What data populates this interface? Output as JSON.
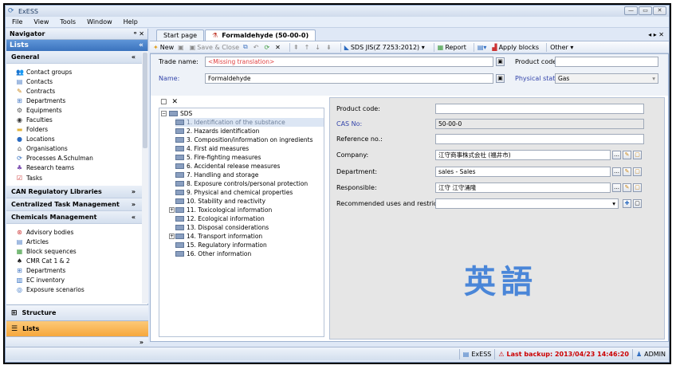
{
  "window": {
    "title": "ExESS",
    "min": "—",
    "max": "▭",
    "close": "✕"
  },
  "menu": [
    "File",
    "View",
    "Tools",
    "Window",
    "Help"
  ],
  "navigator": {
    "title": "Navigator",
    "pin": "ᵒ ✕",
    "lists_label": "Lists",
    "lists_chevron": "«",
    "groups": [
      {
        "label": "General",
        "chevron": "«",
        "items": [
          "Contact groups",
          "Contacts",
          "Contracts",
          "Departments",
          "Equipments",
          "Faculties",
          "Folders",
          "Locations",
          "Organisations",
          "Processes A.Schulman",
          "Research teams",
          "Tasks"
        ]
      },
      {
        "label": "CAN Regulatory Libraries",
        "chevron": "»",
        "items": []
      },
      {
        "label": "Centralized Task Management",
        "chevron": "»",
        "items": []
      },
      {
        "label": "Chemicals Management",
        "chevron": "«",
        "items": [
          "Advisory bodies",
          "Articles",
          "Block sequences",
          "CMR Cat 1 & 2",
          "Departments",
          "EC inventory",
          "Exposure scenarios"
        ]
      }
    ],
    "structure_label": "Structure",
    "lists_button_label": "Lists",
    "more": "»"
  },
  "tabs": [
    {
      "label": "Start page"
    },
    {
      "label": "Formaldehyde (50-00-0)"
    }
  ],
  "tab_controls": "◂ ▸ ✕",
  "toolbar": {
    "new": "New",
    "save_close": "Save & Close",
    "sds": "SDS JIS(Z 7253:2012)",
    "report": "Report",
    "apply_blocks": "Apply blocks",
    "other": "Other"
  },
  "header": {
    "trade_name_label": "Trade name:",
    "trade_name_value": "<Missing translation>",
    "product_code_label": "Product code:",
    "product_code_value": "",
    "name_label": "Name:",
    "name_value": "Formaldehyde",
    "physical_state_label": "Physical state:",
    "physical_state_value": "Gas"
  },
  "tree": {
    "root": "SDS",
    "nodes": [
      "1. Identification of the substance",
      "2. Hazards identification",
      "3. Composition/information on ingredients",
      "4. First aid measures",
      "5. Fire-fighting measures",
      "6. Accidental release measures",
      "7. Handling and storage",
      "8. Exposure controls/personal protection",
      "9. Physical and chemical properties",
      "10. Stability and reactivity",
      "11. Toxicological information",
      "12. Ecological information",
      "13. Disposal considerations",
      "14. Transport information",
      "15. Regulatory information",
      "16. Other information"
    ]
  },
  "detail": {
    "product_code_label": "Product code:",
    "product_code_value": "",
    "cas_label": "CAS No:",
    "cas_value": "50-00-0",
    "reference_label": "Reference no.:",
    "reference_value": "",
    "company_label": "Company:",
    "company_value": "江守商事株式会社 (福井市)",
    "department_label": "Department:",
    "department_value": "sales - Sales",
    "responsible_label": "Responsible:",
    "responsible_value": "江守 江守涌隆",
    "recommended_label": "Recommended uses and restrictions:",
    "recommended_value": "",
    "watermark": "英語"
  },
  "status": {
    "app": "ExESS",
    "backup": "Last backup: 2013/04/23 14:46:20",
    "user": "ADMIN"
  }
}
